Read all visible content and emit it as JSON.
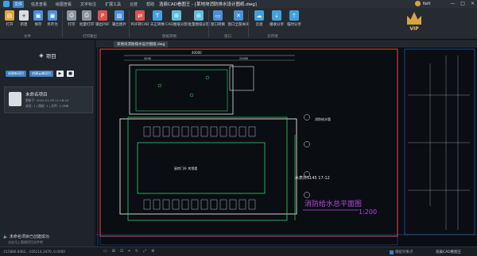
{
  "titlebar": {
    "tabs": [
      "文件",
      "信息查看",
      "绘图查看",
      "文字标注",
      "扩展工具",
      "云技",
      "帮助"
    ],
    "window_title": "浩辰CAD看图王 - [某地块消防排水设计图纸.dwg]",
    "user_name": "Kelt",
    "window_buttons": [
      "—",
      "□",
      "×"
    ]
  },
  "ribbon": {
    "tools": [
      {
        "label": "打开",
        "icon": "open-icon",
        "color": "#e0a33b"
      },
      {
        "label": "新建",
        "icon": "new-icon",
        "color": "#d9dee4"
      },
      {
        "label": "保存",
        "icon": "save-icon",
        "color": "#4a90d9"
      },
      {
        "label": "另存为",
        "icon": "save-as-icon",
        "color": "#4a90d9"
      },
      {
        "label": "打印",
        "icon": "print-icon",
        "color": "#8a949e"
      },
      {
        "label": "批量打印",
        "icon": "batch-print-icon",
        "color": "#8a949e"
      },
      {
        "label": "输出PDF",
        "icon": "pdf-export-icon",
        "color": "#d9534f"
      },
      {
        "label": "输出图片",
        "icon": "image-export-icon",
        "color": "#4a90d9"
      },
      {
        "label": "PDF转CAD",
        "icon": "pdf-to-cad-icon",
        "color": "#d9534f"
      },
      {
        "label": "天正转换",
        "icon": "tangent-convert-icon",
        "color": "#3fa2e0"
      },
      {
        "label": "CAD图纸分割",
        "icon": "cad-split-icon",
        "color": "#5bc0de"
      },
      {
        "label": "批量图纸分割",
        "icon": "batch-split-icon",
        "color": "#5bc0de"
      },
      {
        "label": "窗口转换",
        "icon": "window-convert-icon",
        "color": "#4a90d9"
      },
      {
        "label": "窗口全部关闭",
        "icon": "close-all-icon",
        "color": "#4a90d9"
      },
      {
        "label": "云盘",
        "icon": "cloud-disk-icon",
        "color": "#3fa2e0"
      },
      {
        "label": "播收分享",
        "icon": "receive-share-icon",
        "color": "#3fa2e0"
      },
      {
        "label": "临时分享",
        "icon": "temp-share-icon",
        "color": "#3fa2e0"
      }
    ],
    "groups": [
      "文件",
      "打印输出",
      "图纸转换",
      "窗口",
      "云存储"
    ],
    "vip_label": "VIP"
  },
  "left_panel": {
    "title": "项目",
    "btn_new_project": "创建新项目",
    "btn_open_project": "创建云端项目",
    "project": {
      "name": "未命名项目",
      "updated": "更新于: 2024-01-09 11:18:24",
      "meta": "成员: 1 | 图纸: 1 | 文件: 1.0MB"
    },
    "notice": "未命名项目已创建成功",
    "notice_sub": "点击马上管理项目文件吧"
  },
  "document": {
    "tab_label": "某地块消防排水设计图纸.dwg"
  },
  "drawing": {
    "labels": {
      "plan_title": "消防给水总平面图",
      "scale": "1:200",
      "elev_note": "水表井S145 17-12",
      "room_label": "厨房门外 宾馆楼",
      "pipe_label": "消防给水管",
      "dim_total": "40000",
      "dim_left": "3200",
      "dim_mid": "22000"
    },
    "colors": {
      "frame": "#d23a3a",
      "wall": "#e6e6e6",
      "pipe": "#2fd36c",
      "dim": "#e0e0e0",
      "note": "#b44be0",
      "grid": "#2f6fd1"
    }
  },
  "statusbar": {
    "coords": "-215886.8462, -105114.2470, 0.0000",
    "tools": [
      "▭",
      "⊞",
      "⊡",
      "⌖",
      "↻",
      "⤢",
      "⚙"
    ],
    "snap_label": "捕捉对象点",
    "brand": "浩辰CAD看图王"
  }
}
